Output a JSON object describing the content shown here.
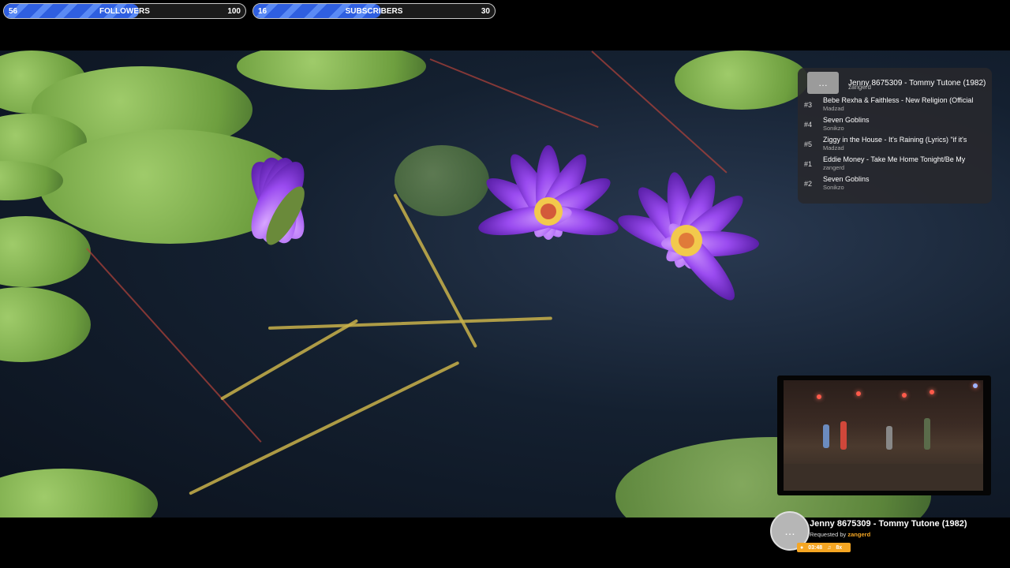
{
  "goals": [
    {
      "current": "56",
      "label": "FOLLOWERS",
      "target": "100",
      "progress": 0.56
    },
    {
      "current": "16",
      "label": "SUBSCRIBERS",
      "target": "30",
      "progress": 0.53
    }
  ],
  "queue": {
    "now": {
      "icon": "more-horizontal-icon",
      "icon_glyph": "…",
      "title": "Jenny 8675309 - Tommy Tutone (1982)",
      "user": "zangerd"
    },
    "items": [
      {
        "pos": "#3",
        "title": "Bebe Rexha & Faithless - New Religion (Official",
        "user": "Madzad"
      },
      {
        "pos": "#4",
        "title": "Seven Goblins",
        "user": "Sonikzo"
      },
      {
        "pos": "#5",
        "title": "Ziggy in the House - It's Raining (Lyrics) \"if it's",
        "user": "Madzad"
      },
      {
        "pos": "#1",
        "title": "Eddie Money - Take Me Home Tonight/Be My",
        "user": "zangerd"
      },
      {
        "pos": "#2",
        "title": "Seven Goblins",
        "user": "Sonikzo"
      }
    ]
  },
  "now_playing": {
    "avatar_glyph": "…",
    "title": "Jenny 8675309 - Tommy Tutone (1982)",
    "requested_prefix": "Requested by",
    "requested_user": "zangerd",
    "time": "03:48",
    "volume": "8x",
    "accent": "#f5a623"
  },
  "colors": {
    "goal_fill": "#2f5fe0",
    "panel_bg": "#28282c"
  }
}
